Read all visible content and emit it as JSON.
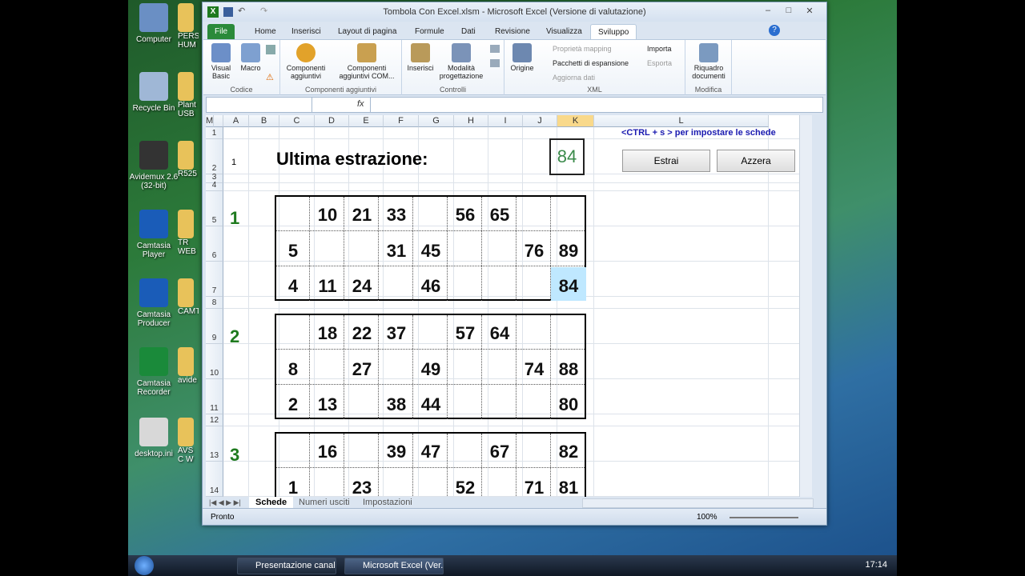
{
  "desktop": {
    "icons": [
      {
        "label": "Computer",
        "color": "#6a8fc4"
      },
      {
        "label": "Recycle Bin",
        "color": "#9fb7d6"
      },
      {
        "label": "Avidemux 2.6 (32-bit)",
        "color": "#333"
      },
      {
        "label": "Camtasia Player",
        "color": "#1a5cb8"
      },
      {
        "label": "Camtasia Producer",
        "color": "#1a5cb8"
      },
      {
        "label": "Camtasia Recorder",
        "color": "#1a8a3a"
      },
      {
        "label": "desktop.ini",
        "color": "#d8d8d8"
      }
    ],
    "icons2": [
      "PERS HUM",
      "Plant USB",
      "R525",
      "TR WEB",
      "CAMT",
      "avide",
      "AVS C W"
    ]
  },
  "window": {
    "title": "Tombola Con Excel.xlsm - Microsoft Excel (Versione di valutazione)",
    "min": "–",
    "max": "□",
    "close": "✕"
  },
  "ribbon": {
    "tabs": [
      "File",
      "Home",
      "Inserisci",
      "Layout di pagina",
      "Formule",
      "Dati",
      "Revisione",
      "Visualizza",
      "Sviluppo"
    ],
    "codice": {
      "label": "Codice",
      "vb": "Visual Basic",
      "macro": "Macro"
    },
    "comp": {
      "label": "Componenti aggiuntivi",
      "c1": "Componenti aggiuntivi",
      "c2": "Componenti aggiuntivi COM..."
    },
    "controlli": {
      "label": "Controlli",
      "ins": "Inserisci",
      "mod": "Modalità progettazione"
    },
    "xml": {
      "label": "XML",
      "origine": "Origine",
      "pm": "Proprietà mapping",
      "pe": "Pacchetti di espansione",
      "ad": "Aggiorna dati",
      "imp": "Importa",
      "esp": "Esporta"
    },
    "modifica": {
      "label": "Modifica",
      "rq": "Riquadro documenti"
    }
  },
  "formula": {
    "fx": "fx",
    "value": ""
  },
  "columns": [
    "A",
    "B",
    "C",
    "D",
    "E",
    "F",
    "G",
    "H",
    "I",
    "J",
    "K",
    "L",
    "M"
  ],
  "rows": [
    "1",
    "2",
    "3",
    "4",
    "5",
    "6",
    "7",
    "8",
    "9",
    "10",
    "11",
    "12",
    "13",
    "14"
  ],
  "sheet": {
    "hint": "<CTRL + s > per impostare le schede",
    "row2a": "1",
    "last_label": "Ultima estrazione:",
    "last_value": "84",
    "btn_estrai": "Estrai",
    "btn_azzera": "Azzera"
  },
  "cards": [
    {
      "label": "1",
      "rows": [
        [
          "",
          "10",
          "21",
          "33",
          "",
          "56",
          "65",
          "",
          ""
        ],
        [
          "5",
          "",
          "",
          "31",
          "45",
          "",
          "",
          "76",
          "89"
        ],
        [
          "4",
          "11",
          "24",
          "",
          "46",
          "",
          "",
          "",
          "84"
        ]
      ]
    },
    {
      "label": "2",
      "rows": [
        [
          "",
          "18",
          "22",
          "37",
          "",
          "57",
          "64",
          "",
          ""
        ],
        [
          "8",
          "",
          "27",
          "",
          "49",
          "",
          "",
          "74",
          "88"
        ],
        [
          "2",
          "13",
          "",
          "38",
          "44",
          "",
          "",
          "",
          "80"
        ]
      ]
    },
    {
      "label": "3",
      "rows": [
        [
          "",
          "16",
          "",
          "39",
          "47",
          "",
          "67",
          "",
          "82"
        ],
        [
          "1",
          "",
          "23",
          "",
          "",
          "52",
          "",
          "71",
          "81"
        ]
      ]
    }
  ],
  "sheettabs": [
    "Schede",
    "Numeri usciti",
    "Impostazioni"
  ],
  "status": {
    "ready": "Pronto",
    "zoom": "100%"
  },
  "taskbar": {
    "b1": "Presentazione canal...",
    "b2": "Microsoft Excel (Ver...",
    "clock": "17:14"
  }
}
